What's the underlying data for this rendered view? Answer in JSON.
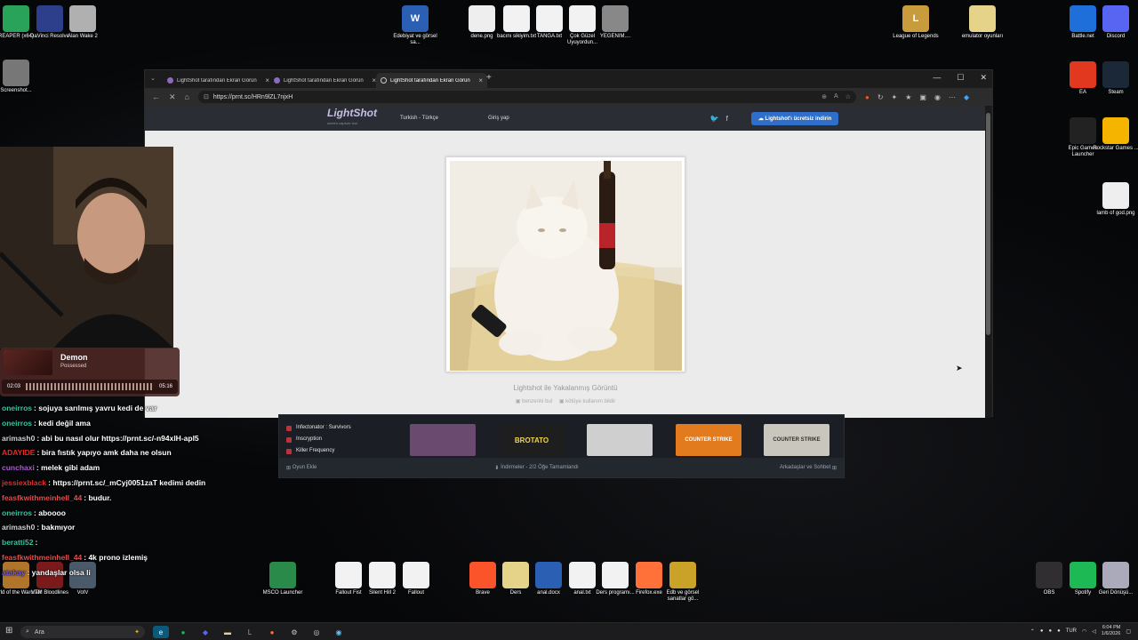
{
  "desktop": {
    "left_icons": [
      {
        "label": "REAPER (x64)",
        "color": "#2aa35a"
      },
      {
        "label": "DaVinci Resolve",
        "color": "#2d3e8a"
      },
      {
        "label": "Alan Wake 2",
        "color": "#b0b0b0"
      },
      {
        "label": "Screenshot...",
        "color": "#777"
      },
      {
        "label": "World of the Warcraft",
        "color": "#b0752a"
      },
      {
        "label": "VTM Bloodlines",
        "color": "#7a1a1a"
      },
      {
        "label": "VotV",
        "color": "#4a5a6a"
      }
    ],
    "top_icons": [
      {
        "label": "Edebiyat ve görsel sa...",
        "color": "#2b5fb3",
        "text": "W"
      },
      {
        "label": "dene.png",
        "color": "#eee",
        "text": ""
      },
      {
        "label": "bacını sikiyim.txt",
        "color": "#f2f2f2",
        "text": ""
      },
      {
        "label": "TANGA.txt",
        "color": "#f2f2f2",
        "text": ""
      },
      {
        "label": "Çok Güzel Uyuyordun...",
        "color": "#f2f2f2",
        "text": ""
      },
      {
        "label": "YEGENIM....",
        "color": "#888",
        "text": ""
      },
      {
        "label": "League of Legends",
        "color": "#c89b3c",
        "text": "L"
      },
      {
        "label": "emulator oyunları",
        "color": "#e6d38a",
        "text": ""
      }
    ],
    "right_icons": [
      {
        "label": "Battle.net",
        "color": "#1e6fd9"
      },
      {
        "label": "Discord",
        "color": "#5865f2"
      },
      {
        "label": "EA",
        "color": "#e2381f"
      },
      {
        "label": "Steam",
        "color": "#1b2838"
      },
      {
        "label": "Epic Games Launcher",
        "color": "#222"
      },
      {
        "label": "Rockstar Games ...",
        "color": "#f4b400"
      },
      {
        "label": "lamb of god.png",
        "color": "#eee"
      }
    ],
    "bottom_icons": [
      {
        "label": "MSCO Launcher",
        "color": "#2a8a4a"
      },
      {
        "label": "Fallout Fist",
        "color": "#f2f2f2"
      },
      {
        "label": "Silent Hill 2",
        "color": "#f2f2f2"
      },
      {
        "label": "Fallout",
        "color": "#f2f2f2"
      },
      {
        "label": "Brave",
        "color": "#fb542b"
      },
      {
        "label": "Ders",
        "color": "#e6d38a"
      },
      {
        "label": "anal.docx",
        "color": "#2b5fb3"
      },
      {
        "label": "anal.txt",
        "color": "#f2f2f2"
      },
      {
        "label": "Ders programı...",
        "color": "#f2f2f2"
      },
      {
        "label": "Firefox.exe",
        "color": "#ff7139"
      },
      {
        "label": "Edb ve görsel sanatlar gö...",
        "color": "#c9a227"
      },
      {
        "label": "OBS",
        "color": "#302e31"
      },
      {
        "label": "Spotify",
        "color": "#1db954"
      },
      {
        "label": "Geri Dönüşü...",
        "color": "#aab"
      }
    ]
  },
  "browser": {
    "tabs": [
      "LightShot tarafından Ekran Görün",
      "LightShot tarafından Ekran Görün",
      "LightShot tarafından Ekran Görün"
    ],
    "url": "https://prnt.sc/HRn9lZL7njxH",
    "new_tab": "+"
  },
  "lightshot": {
    "logo": "LightShot",
    "logo_sub": "screen capture tool",
    "language": "Turkish - Türkçe",
    "login": "Giriş yap",
    "download": "Lightshot'ı ücretsiz indirin",
    "caption": "Lightshot ile Yakalanmış Görüntü",
    "link_similar": "benzerini bul",
    "link_report": "kötüye kullanım bildir"
  },
  "steam": {
    "games": [
      "Infectonator : Survivors",
      "Inscryption",
      "Killer Frequency"
    ],
    "tiles": [
      {
        "text": "",
        "color": "#6a4a6e"
      },
      {
        "text": "BROTATO",
        "color": "#1e1e1e"
      },
      {
        "text": "",
        "color": "#cfcfcf"
      },
      {
        "text": "COUNTER STRIKE",
        "color": "#e27a1e"
      },
      {
        "text": "COUNTER STRIKE",
        "color": "#c9c6bd"
      }
    ],
    "footer_left": "Oyun Ekle",
    "footer_mid": "İndirmeler - 2/2 Öğe Tamamlandı",
    "footer_right": "Arkadaşlar ve Sohbet"
  },
  "music": {
    "title": "Demon",
    "artist": "Possessed",
    "elapsed": "02:03",
    "total": "05:16"
  },
  "chat": [
    {
      "user": "oneirros",
      "color": "#36c7a4",
      "msg": "sojuya sarılmış yavru kedi de var"
    },
    {
      "user": "oneirros",
      "color": "#36c7a4",
      "msg": "kedi değil ama"
    },
    {
      "user": "arimash0",
      "color": "#d0d0d0",
      "msg": "abi bu nasıl olur https://prnt.sc/-n94xlH-apl5"
    },
    {
      "user": "ADAYIDE",
      "color": "#e0302b",
      "msg": "bira fıstık yapıyo amk daha ne olsun"
    },
    {
      "user": "cunchaxi",
      "color": "#b05ad8",
      "msg": "melek gibi adam"
    },
    {
      "user": "jessiexblack",
      "color": "#e0302b",
      "msg": "https://prnt.sc/_mCyj0051zaT kedimi dedin"
    },
    {
      "user": "feasfkwithmeinhell_44",
      "color": "#e05050",
      "msg": "budur."
    },
    {
      "user": "oneirros",
      "color": "#36c7a4",
      "msg": "aboooo"
    },
    {
      "user": "arimash0",
      "color": "#d0d0d0",
      "msg": "bakmıyor"
    },
    {
      "user": "beratti52",
      "color": "#36c7a4",
      "msg": ""
    },
    {
      "user": "feasfkwithmeinhell_44",
      "color": "#e05050",
      "msg": "4k prono izlemiş"
    },
    {
      "user": "atakay",
      "color": "#7a5ae0",
      "msg": "yandaşlar olsa li"
    }
  ],
  "taskbar": {
    "search": "Ara",
    "lang": "TUR",
    "time": "6:04 PM",
    "date": "1/6/2026"
  }
}
